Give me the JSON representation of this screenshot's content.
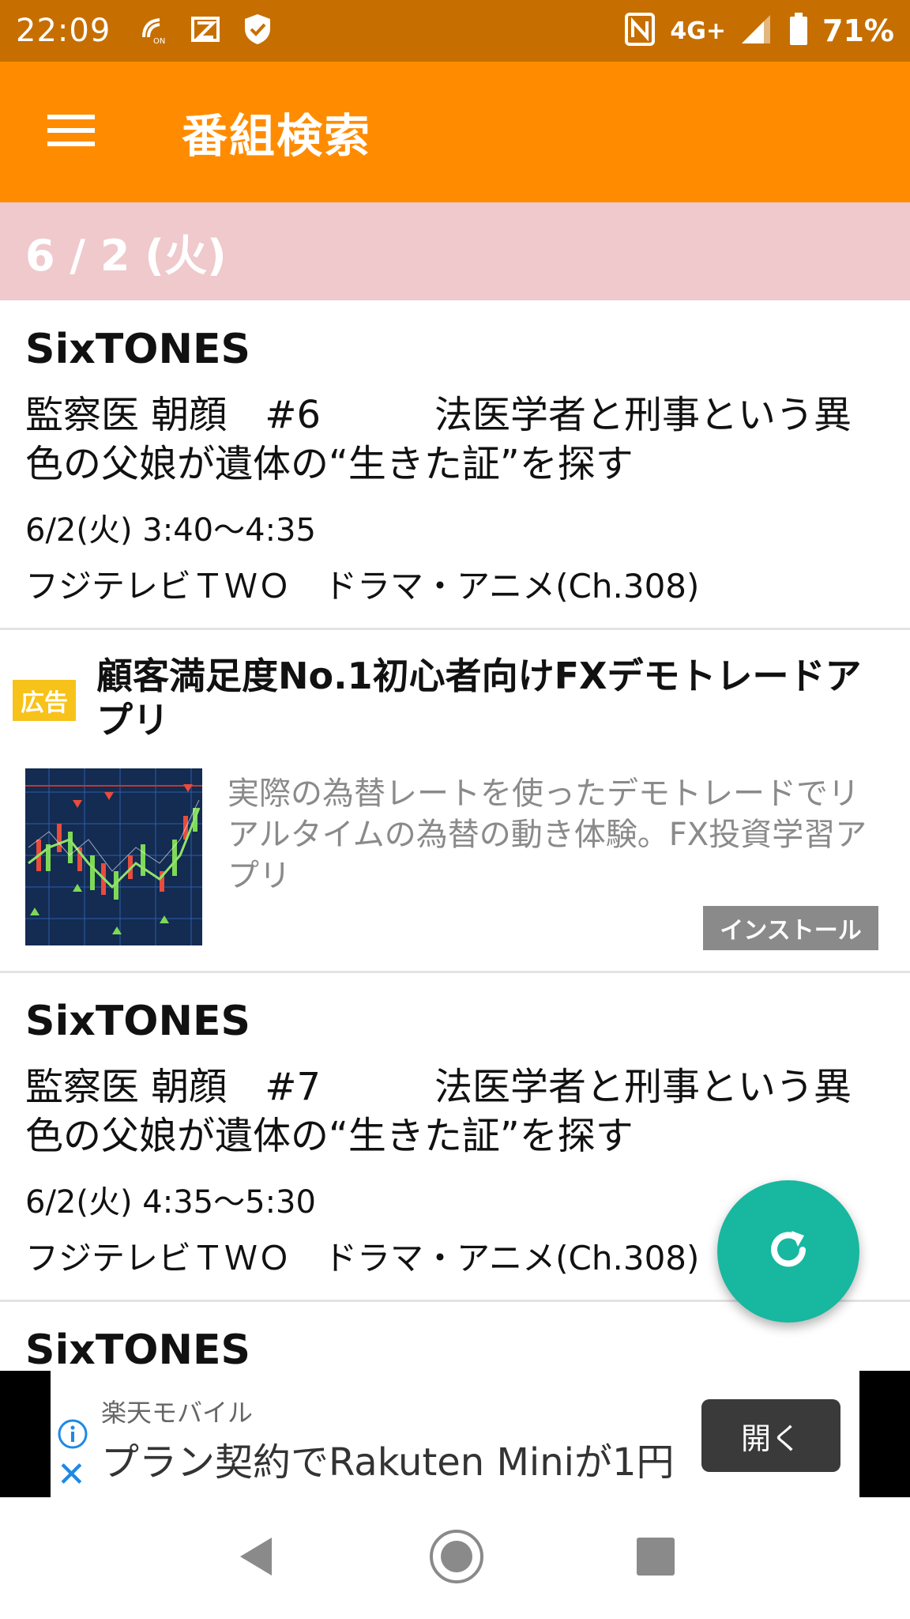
{
  "status_bar": {
    "time": "22:09",
    "network": "4G+",
    "battery": "71%",
    "background": "#c66f00"
  },
  "app_bar": {
    "title": "番組検索",
    "menu_icon": "hamburger-menu-icon",
    "background": "#ff8c00"
  },
  "date_header": {
    "date": "6 / 2 (火)",
    "background": "#efc9cc"
  },
  "programs": [
    {
      "group": "SixTONES",
      "title": "監察医 朝顔　#6　　　法医学者と刑事という異色の父娘が遺体の“生きた証”を探す",
      "time": "6/2(火) 3:40〜4:35",
      "channel": "フジテレビＴＷＯ　ドラマ・アニメ(Ch.308)"
    },
    {
      "group": "SixTONES",
      "title": "監察医 朝顔　#7　　　法医学者と刑事という異色の父娘が遺体の“生きた証”を探す",
      "time": "6/2(火) 4:35〜5:30",
      "channel": "フジテレビＴＷＯ　ドラマ・アニメ(Ch.308)"
    },
    {
      "group": "SixTONES"
    }
  ],
  "ad": {
    "badge": "広告",
    "title": "顧客満足度No.1初心者向けFXデモトレードアプリ",
    "description": "実際の為替レートを使ったデモトレードでリアルタイムの為替の動き体験。FX投資学習アプリ",
    "install_label": "インストール"
  },
  "fab": {
    "icon": "refresh-icon",
    "color": "#17b7a0"
  },
  "banner": {
    "advertiser": "楽天モバイル",
    "text": "プラン契約でRakuten Miniが1円",
    "open_label": "開く"
  },
  "nav_bar": {
    "icons": [
      "back-icon",
      "home-icon",
      "recents-icon"
    ]
  }
}
